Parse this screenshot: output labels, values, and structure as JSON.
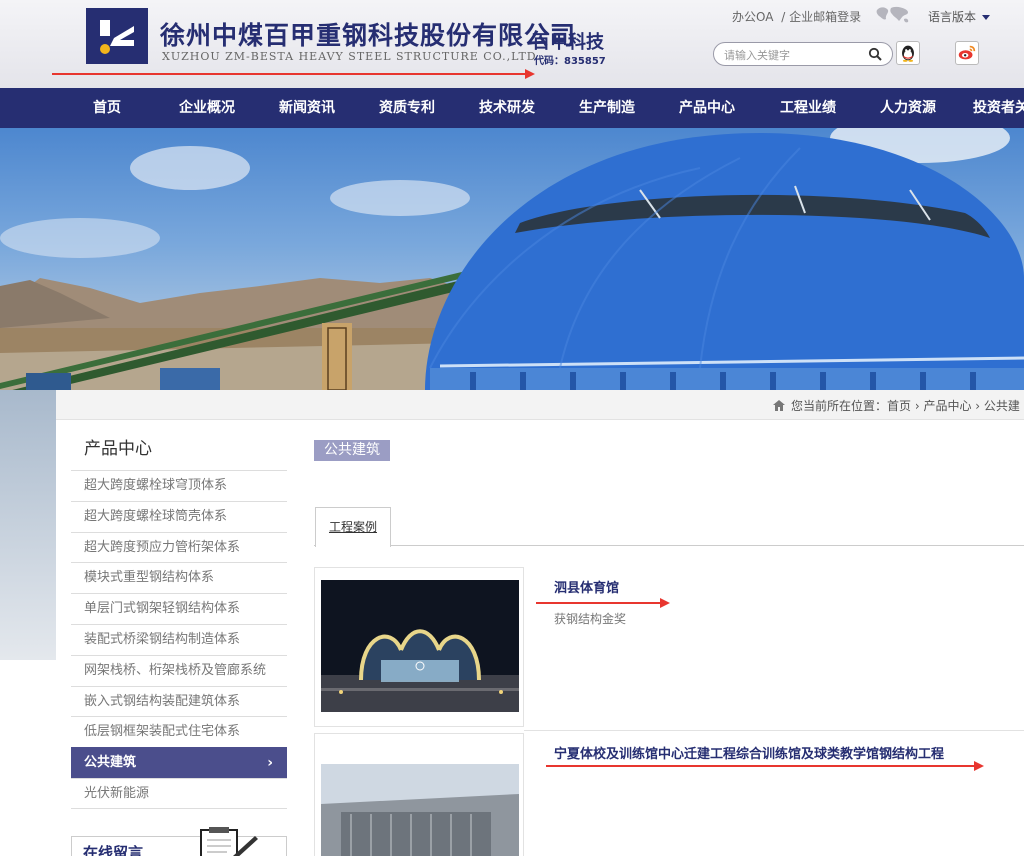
{
  "header": {
    "company_cn": "徐州中煤百甲重钢科技股份有限公司",
    "company_en": "XUZHOU ZM-BESTA HEAVY STEEL STRUCTURE CO.,LTD",
    "brand": "百甲科技",
    "stock_code": "代码：835857",
    "links": [
      "办公OA",
      "/ 企业邮箱登录"
    ],
    "language": "语言版本",
    "search_placeholder": "请输入关键字",
    "colors": {
      "navy": "#262e72",
      "red": "#e8362f"
    }
  },
  "nav": {
    "items": [
      "首页",
      "企业概况",
      "新闻资讯",
      "资质专利",
      "技术研发",
      "生产制造",
      "产品中心",
      "工程业绩",
      "人力资源",
      "投资者关"
    ]
  },
  "breadcrumb": {
    "prefix": "您当前所在位置：",
    "items": [
      "首页",
      "产品中心",
      "公共建"
    ]
  },
  "sidebar": {
    "title": "产品中心",
    "items": [
      {
        "label": "超大跨度螺栓球穹顶体系",
        "active": false
      },
      {
        "label": "超大跨度螺栓球筒壳体系",
        "active": false
      },
      {
        "label": "超大跨度预应力管桁架体系",
        "active": false
      },
      {
        "label": "模块式重型钢结构体系",
        "active": false
      },
      {
        "label": "单层门式钢架轻钢结构体系",
        "active": false
      },
      {
        "label": "装配式桥梁钢结构制造体系",
        "active": false
      },
      {
        "label": "网架栈桥、桁架栈桥及管廊系统",
        "active": false
      },
      {
        "label": "嵌入式钢结构装配建筑体系",
        "active": false
      },
      {
        "label": "低层钢框架装配式住宅体系",
        "active": false
      },
      {
        "label": "公共建筑",
        "active": true
      },
      {
        "label": "光伏新能源",
        "active": false
      }
    ],
    "message_label": "在线留言"
  },
  "main": {
    "section_title": "公共建筑",
    "tab_label": "工程案例",
    "projects": [
      {
        "title": "泗县体育馆",
        "desc": "获钢结构金奖"
      },
      {
        "title": "宁夏体校及训练馆中心迁建工程综合训练馆及球类教学馆钢结构工程",
        "desc": ""
      }
    ]
  }
}
